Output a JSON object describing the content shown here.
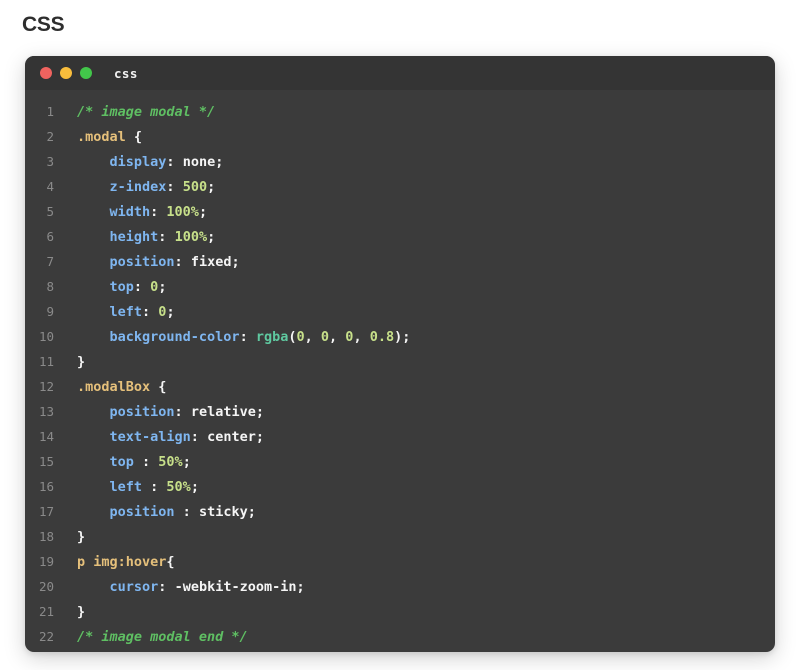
{
  "page": {
    "heading": "CSS",
    "background_color": "#ffffff"
  },
  "window": {
    "title": "css",
    "background_color": "#3b3b3b",
    "titlebar_color": "#343434",
    "traffic_lights": [
      {
        "name": "close",
        "color": "#f0635f"
      },
      {
        "name": "minimize",
        "color": "#f8bd3c"
      },
      {
        "name": "maximize",
        "color": "#42c64a"
      }
    ]
  },
  "editor": {
    "language": "css",
    "line_count": 22,
    "theme": {
      "comment": "#5fbf63",
      "selector": "#e5c07b",
      "property": "#7fb6f0",
      "value": "#f5f5f5",
      "number": "#c7e08a",
      "function": "#5fc9a0",
      "line_number": "#8a8a8a"
    },
    "lines": [
      {
        "n": "1",
        "text": "/* image modal */"
      },
      {
        "n": "2",
        "text": ".modal {"
      },
      {
        "n": "3",
        "text": "    display: none;"
      },
      {
        "n": "4",
        "text": "    z-index: 500;"
      },
      {
        "n": "5",
        "text": "    width: 100%;"
      },
      {
        "n": "6",
        "text": "    height: 100%;"
      },
      {
        "n": "7",
        "text": "    position: fixed;"
      },
      {
        "n": "8",
        "text": "    top: 0;"
      },
      {
        "n": "9",
        "text": "    left: 0;"
      },
      {
        "n": "10",
        "text": "    background-color: rgba(0, 0, 0, 0.8);"
      },
      {
        "n": "11",
        "text": "}"
      },
      {
        "n": "12",
        "text": ".modalBox {"
      },
      {
        "n": "13",
        "text": "    position: relative;"
      },
      {
        "n": "14",
        "text": "    text-align: center;"
      },
      {
        "n": "15",
        "text": "    top : 50%;"
      },
      {
        "n": "16",
        "text": "    left : 50%;"
      },
      {
        "n": "17",
        "text": "    position : sticky;"
      },
      {
        "n": "18",
        "text": "}"
      },
      {
        "n": "19",
        "text": "p img:hover{"
      },
      {
        "n": "20",
        "text": "    cursor: -webkit-zoom-in;"
      },
      {
        "n": "21",
        "text": "}"
      },
      {
        "n": "22",
        "text": "/* image modal end */"
      }
    ],
    "tokens": [
      [
        {
          "c": "comment",
          "t": "/* image modal */"
        }
      ],
      [
        {
          "c": "selector",
          "t": ".modal "
        },
        {
          "c": "punct",
          "t": "{"
        }
      ],
      [
        {
          "c": "plain",
          "t": "    "
        },
        {
          "c": "prop",
          "t": "display"
        },
        {
          "c": "punct",
          "t": ": "
        },
        {
          "c": "value",
          "t": "none;"
        }
      ],
      [
        {
          "c": "plain",
          "t": "    "
        },
        {
          "c": "prop",
          "t": "z-index"
        },
        {
          "c": "punct",
          "t": ": "
        },
        {
          "c": "number",
          "t": "500"
        },
        {
          "c": "punct",
          "t": ";"
        }
      ],
      [
        {
          "c": "plain",
          "t": "    "
        },
        {
          "c": "prop",
          "t": "width"
        },
        {
          "c": "punct",
          "t": ": "
        },
        {
          "c": "number",
          "t": "100%"
        },
        {
          "c": "punct",
          "t": ";"
        }
      ],
      [
        {
          "c": "plain",
          "t": "    "
        },
        {
          "c": "prop",
          "t": "height"
        },
        {
          "c": "punct",
          "t": ": "
        },
        {
          "c": "number",
          "t": "100%"
        },
        {
          "c": "punct",
          "t": ";"
        }
      ],
      [
        {
          "c": "plain",
          "t": "    "
        },
        {
          "c": "prop",
          "t": "position"
        },
        {
          "c": "punct",
          "t": ": "
        },
        {
          "c": "value",
          "t": "fixed;"
        }
      ],
      [
        {
          "c": "plain",
          "t": "    "
        },
        {
          "c": "prop",
          "t": "top"
        },
        {
          "c": "punct",
          "t": ": "
        },
        {
          "c": "number",
          "t": "0"
        },
        {
          "c": "punct",
          "t": ";"
        }
      ],
      [
        {
          "c": "plain",
          "t": "    "
        },
        {
          "c": "prop",
          "t": "left"
        },
        {
          "c": "punct",
          "t": ": "
        },
        {
          "c": "number",
          "t": "0"
        },
        {
          "c": "punct",
          "t": ";"
        }
      ],
      [
        {
          "c": "plain",
          "t": "    "
        },
        {
          "c": "prop",
          "t": "background-color"
        },
        {
          "c": "punct",
          "t": ": "
        },
        {
          "c": "func",
          "t": "rgba"
        },
        {
          "c": "punct",
          "t": "("
        },
        {
          "c": "number",
          "t": "0"
        },
        {
          "c": "punct",
          "t": ", "
        },
        {
          "c": "number",
          "t": "0"
        },
        {
          "c": "punct",
          "t": ", "
        },
        {
          "c": "number",
          "t": "0"
        },
        {
          "c": "punct",
          "t": ", "
        },
        {
          "c": "number",
          "t": "0.8"
        },
        {
          "c": "punct",
          "t": ");"
        }
      ],
      [
        {
          "c": "punct",
          "t": "}"
        }
      ],
      [
        {
          "c": "selector",
          "t": ".modalBox "
        },
        {
          "c": "punct",
          "t": "{"
        }
      ],
      [
        {
          "c": "plain",
          "t": "    "
        },
        {
          "c": "prop",
          "t": "position"
        },
        {
          "c": "punct",
          "t": ": "
        },
        {
          "c": "value",
          "t": "relative;"
        }
      ],
      [
        {
          "c": "plain",
          "t": "    "
        },
        {
          "c": "prop",
          "t": "text-align"
        },
        {
          "c": "punct",
          "t": ": "
        },
        {
          "c": "value",
          "t": "center;"
        }
      ],
      [
        {
          "c": "plain",
          "t": "    "
        },
        {
          "c": "prop",
          "t": "top"
        },
        {
          "c": "punct",
          "t": " : "
        },
        {
          "c": "number",
          "t": "50%"
        },
        {
          "c": "punct",
          "t": ";"
        }
      ],
      [
        {
          "c": "plain",
          "t": "    "
        },
        {
          "c": "prop",
          "t": "left"
        },
        {
          "c": "punct",
          "t": " : "
        },
        {
          "c": "number",
          "t": "50%"
        },
        {
          "c": "punct",
          "t": ";"
        }
      ],
      [
        {
          "c": "plain",
          "t": "    "
        },
        {
          "c": "prop",
          "t": "position"
        },
        {
          "c": "punct",
          "t": " : "
        },
        {
          "c": "value",
          "t": "sticky;"
        }
      ],
      [
        {
          "c": "punct",
          "t": "}"
        }
      ],
      [
        {
          "c": "selector",
          "t": "p img:hover"
        },
        {
          "c": "punct",
          "t": "{"
        }
      ],
      [
        {
          "c": "plain",
          "t": "    "
        },
        {
          "c": "prop",
          "t": "cursor"
        },
        {
          "c": "punct",
          "t": ": "
        },
        {
          "c": "value",
          "t": "-webkit-zoom-in;"
        }
      ],
      [
        {
          "c": "punct",
          "t": "}"
        }
      ],
      [
        {
          "c": "comment",
          "t": "/* image modal end */"
        }
      ]
    ]
  }
}
